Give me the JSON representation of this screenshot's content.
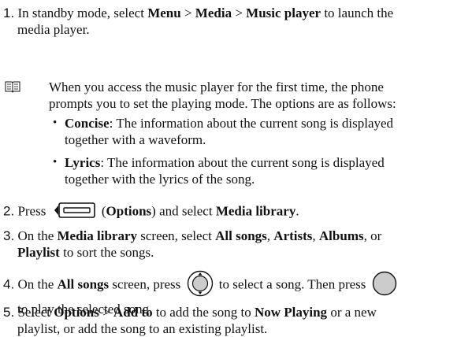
{
  "steps": [
    {
      "num": "1.",
      "a": "In standby mode, select ",
      "b1": "Menu",
      "s1": " > ",
      "b2": "Media",
      "s2": " > ",
      "b3": "Music player",
      "c": " to launch the",
      "d": "media player."
    },
    {
      "num": "2.",
      "a": " Press ",
      "b": " (",
      "b1": "Options",
      "c": ") and select ",
      "b2": "Media library",
      "d": "."
    },
    {
      "num": "3.",
      "a": " On the ",
      "b1": "Media library",
      "c": " screen, select ",
      "b2": "All songs",
      "s1": ", ",
      "b3": "Artists",
      "s2": ", ",
      "b4": "Albums",
      "s3": ", or",
      "b5": "Playlist",
      "d": " to sort the songs."
    },
    {
      "num": "4.",
      "a": " On the ",
      "b1": "All songs",
      "c": " screen, press ",
      "e": " to select a song. Then press ",
      "f": "to play the selected song."
    },
    {
      "num": "5.",
      "a": " Select ",
      "b1": "Options",
      "s1": " > ",
      "b2": "Add to",
      "c": " to add the song to ",
      "b3": "Now Playing",
      "d": " or a new",
      "e": "playlist, or add the song to an existing playlist."
    }
  ],
  "note": {
    "icon": "book-icon",
    "text1": "When you access the music player for the first time, the phone",
    "text2": "prompts you to set the playing mode. The options are as follows:",
    "bullets": [
      {
        "term": "Concise",
        "l1": ": The information about the current song is displayed",
        "l2": "together with a waveform."
      },
      {
        "term": "Lyrics",
        "l1": ": The information about the current song is displayed",
        "l2": "together with the lyrics of the song."
      }
    ]
  },
  "keys": {
    "options_key": "left-soft-key-icon",
    "nav_key": "navigation-key-icon",
    "ok_key": "ok-key-icon"
  }
}
